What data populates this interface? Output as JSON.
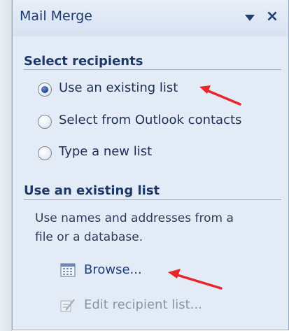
{
  "pane": {
    "title": "Mail Merge",
    "dropdown_icon": "triangle-down-icon",
    "close_label": "×"
  },
  "select_recipients": {
    "heading": "Select recipients",
    "options": [
      {
        "label": "Use an existing list",
        "selected": true
      },
      {
        "label": "Select from Outlook contacts",
        "selected": false
      },
      {
        "label": "Type a new list",
        "selected": false
      }
    ]
  },
  "existing_list": {
    "heading": "Use an existing list",
    "description_line1": "Use names and addresses from a",
    "description_line2": "file or a database.",
    "browse_label": "Browse...",
    "edit_label": "Edit recipient list...",
    "edit_enabled": false
  },
  "annotations": {
    "arrow_color": "#e8262a"
  },
  "colors": {
    "heading": "#1e3866",
    "pane_background": "#e3ebf7",
    "link": "#1e3c78",
    "disabled": "#8a93a3"
  }
}
